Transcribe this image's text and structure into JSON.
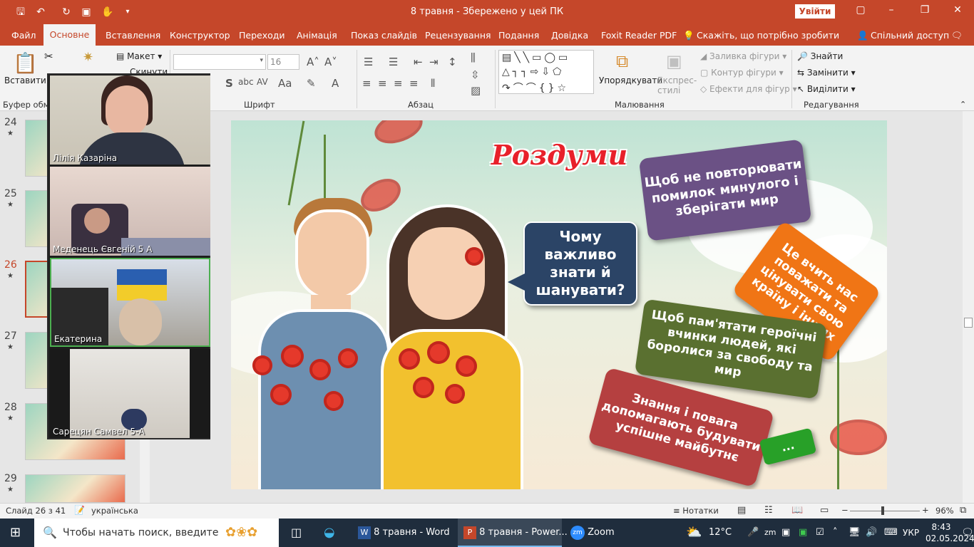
{
  "titlebar": {
    "title": "8 травня  -  Збережено у цей ПК",
    "signin_label": "Увійти"
  },
  "menu": {
    "items": [
      "Файл",
      "Основне",
      "Вставлення",
      "Конструктор",
      "Переходи",
      "Анімація",
      "Показ слайдів",
      "Рецензування",
      "Подання",
      "Довідка",
      "Foxit Reader PDF",
      "Скажіть, що потрібно зробити",
      "Спільний доступ"
    ]
  },
  "ribbon": {
    "paste": "Вставити",
    "layout": "Макет",
    "reset": "Скинути",
    "font_name": "",
    "font_size": "16",
    "arrange": "Упорядкувати",
    "quick_styles": "Експрес-стилі",
    "shape_fill": "Заливка фігури",
    "shape_outline": "Контур фігури",
    "shape_effects": "Ефекти для фігур",
    "find": "Знайти",
    "replace": "Замінити",
    "select": "Виділити",
    "groups": {
      "clipboard": "Буфер обмі",
      "font": "Шрифт",
      "paragraph": "Абзац",
      "drawing": "Малювання",
      "editing": "Редагування"
    }
  },
  "thumbnails": [
    {
      "num": "24",
      "star": "★"
    },
    {
      "num": "25",
      "star": "★"
    },
    {
      "num": "26",
      "star": "★"
    },
    {
      "num": "27",
      "star": "★"
    },
    {
      "num": "28",
      "star": "★"
    },
    {
      "num": "29",
      "star": "★"
    }
  ],
  "slide": {
    "title": "Роздуми",
    "question": "Чому важливо знати й шанувати?",
    "bubble1": "Щоб не повторювати помилок минулого і зберігати мир",
    "bubble2": "Це вчить нас поважати та цінувати свою країну і інших",
    "bubble3": "Щоб пам'ятати героїчні вчинки людей, які боролися за свободу та мир",
    "bubble4": "Знання і повага допомагають будувати успішне майбутнє",
    "bubble5": "...",
    "colors": {
      "question": "#2b4466",
      "bubble1": "#6b5185",
      "bubble2": "#f07515",
      "bubble3": "#5a7030",
      "bubble4": "#b54040",
      "bubble5": "#28a028",
      "title": "#e8202a"
    }
  },
  "video": {
    "participants": [
      {
        "name": "Лілія Казаріна"
      },
      {
        "name": "Меденець Євгеній 5 А"
      },
      {
        "name": "Екатерина"
      },
      {
        "name": "Сарецян Самвел 5-А"
      }
    ]
  },
  "status": {
    "slide_info": "Слайд 26 з 41",
    "language": "українська",
    "notes": "Нотатки",
    "zoom": "96%"
  },
  "taskbar": {
    "search_placeholder": "Чтобы начать поиск, введите",
    "apps": [
      "8 травня - Word",
      "8 травня - Power...",
      "Zoom"
    ],
    "weather": "12°C",
    "lang": "УКР",
    "time": "8:43",
    "date": "02.05.2024"
  }
}
